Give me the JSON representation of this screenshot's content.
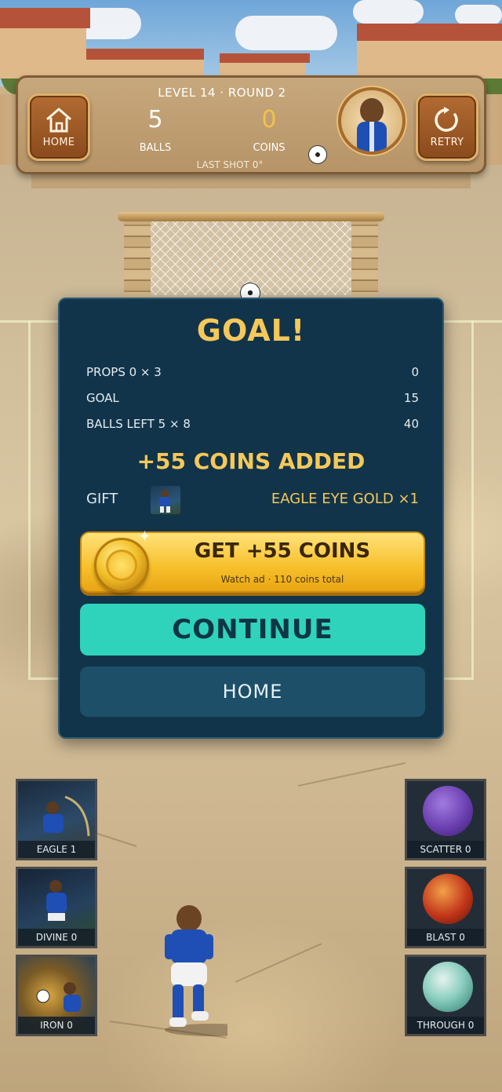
{
  "hud": {
    "level_round": "LEVEL 14 · ROUND 2",
    "balls_value": "5",
    "balls_label": "BALLS",
    "coins_value": "0",
    "coins_label": "COINS",
    "last_shot": "LAST SHOT 0°",
    "home_label": "HOME",
    "retry_label": "RETRY"
  },
  "result": {
    "title": "GOAL!",
    "rows": [
      {
        "label": "PROPS 0 × 3",
        "value": "0"
      },
      {
        "label": "GOAL",
        "value": "15"
      },
      {
        "label": "BALLS LEFT 5 × 8",
        "value": "40"
      }
    ],
    "coins_added": "+55 COINS ADDED",
    "gift_label": "GIFT",
    "gift_name": "EAGLE EYE GOLD ×1",
    "ad_button_label": "GET +55 COINS",
    "ad_button_sub": "Watch ad · 110 coins total",
    "continue_label": "CONTINUE",
    "home_label": "HOME"
  },
  "powerups_left": [
    {
      "label": "EAGLE 1"
    },
    {
      "label": "DIVINE 0"
    },
    {
      "label": "IRON 0"
    }
  ],
  "powerups_right": [
    {
      "label": "SCATTER 0",
      "color": "#6b3fb0"
    },
    {
      "label": "BLAST 0",
      "color": "#c2361a"
    },
    {
      "label": "THROUGH 0",
      "color": "#4aa494"
    }
  ],
  "colors": {
    "modal_bg": "#12344a",
    "accent_gold": "#f5c85a",
    "continue_teal": "#2fd3bb",
    "home_button": "#1d4f68"
  }
}
